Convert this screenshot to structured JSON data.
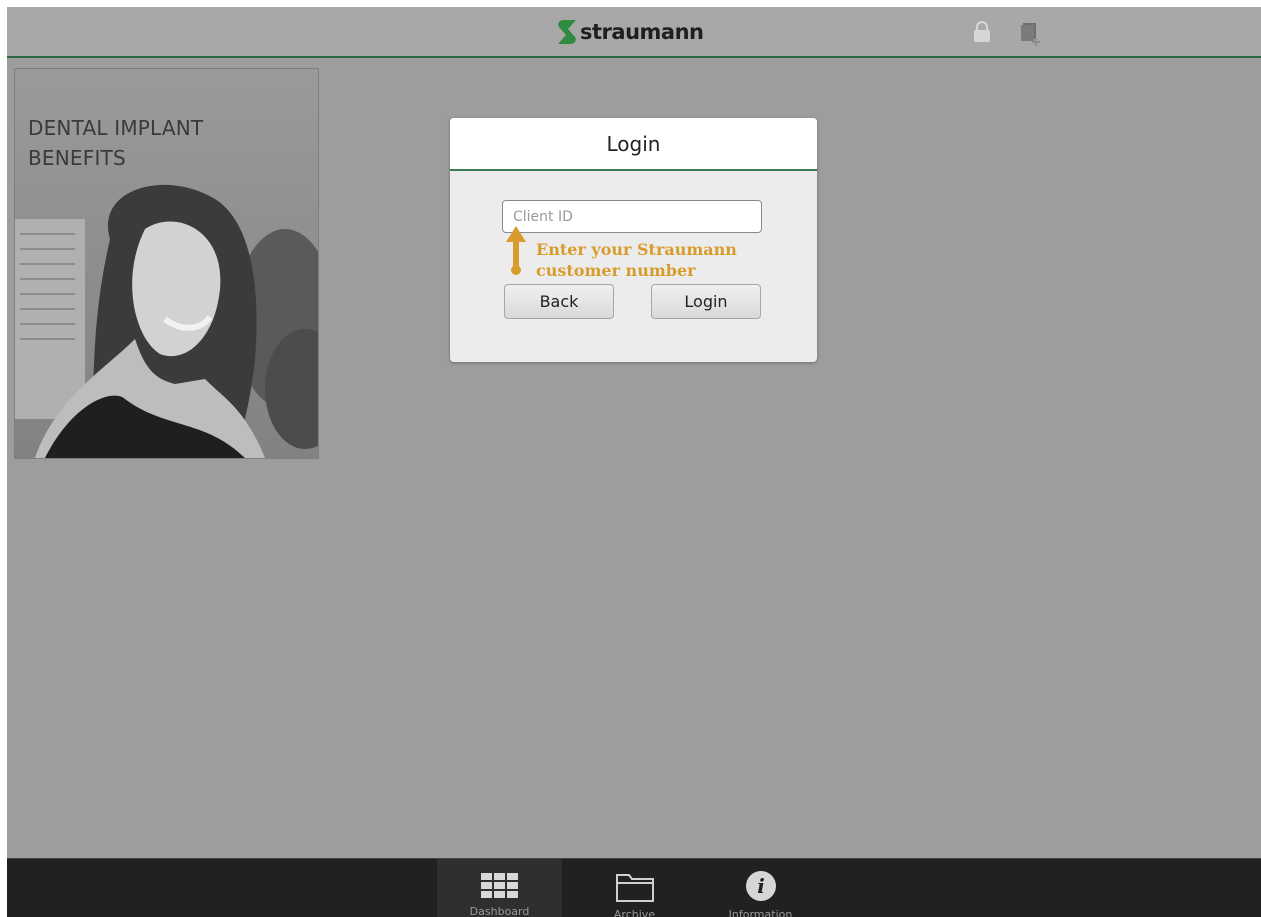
{
  "header": {
    "brand": "straumann",
    "icons": [
      "lock-icon",
      "add-card-icon"
    ],
    "accent_color": "#2d6a45"
  },
  "promo": {
    "title": "DENTAL IMPLANT BENEFITS"
  },
  "login_dialog": {
    "title": "Login",
    "client_id_placeholder": "Client ID",
    "client_id_value": "",
    "back_label": "Back",
    "login_label": "Login"
  },
  "annotation": {
    "line1": "Enter your Straumann",
    "line2": "customer number",
    "color": "#d89c2c"
  },
  "tabbar": {
    "tabs": [
      {
        "label": "Dashboard",
        "icon": "grid-icon",
        "active": true
      },
      {
        "label": "Archive",
        "icon": "folder-icon",
        "active": false
      },
      {
        "label": "Information",
        "icon": "info-icon",
        "active": false
      }
    ]
  }
}
